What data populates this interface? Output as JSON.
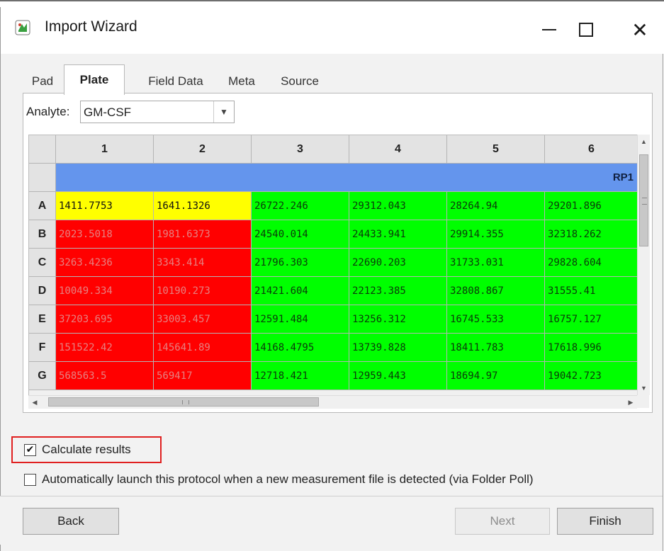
{
  "window": {
    "title": "Import Wizard",
    "icon": "app-icon"
  },
  "tabs": [
    {
      "label": "Pad",
      "active": false
    },
    {
      "label": "Plate",
      "active": true
    },
    {
      "label": "Field Data",
      "active": false
    },
    {
      "label": "Meta",
      "active": false
    },
    {
      "label": "Source",
      "active": false
    }
  ],
  "analyte": {
    "label": "Analyte:",
    "value": "GM-CSF"
  },
  "grid": {
    "columns": [
      "1",
      "2",
      "3",
      "4",
      "5",
      "6"
    ],
    "band_label": "RP1",
    "rows": [
      {
        "label": "A",
        "cells": [
          "1411.7753",
          "1641.1326",
          "26722.246",
          "29312.043",
          "28264.94",
          "29201.896"
        ],
        "colors": [
          "yellow",
          "yellow",
          "green",
          "green",
          "green",
          "green"
        ]
      },
      {
        "label": "B",
        "cells": [
          "2023.5018",
          "1981.6373",
          "24540.014",
          "24433.941",
          "29914.355",
          "32318.262"
        ],
        "colors": [
          "red",
          "red",
          "green",
          "green",
          "green",
          "green"
        ]
      },
      {
        "label": "C",
        "cells": [
          "3263.4236",
          "3343.414",
          "21796.303",
          "22690.203",
          "31733.031",
          "29828.604"
        ],
        "colors": [
          "red",
          "red",
          "green",
          "green",
          "green",
          "green"
        ]
      },
      {
        "label": "D",
        "cells": [
          "10049.334",
          "10190.273",
          "21421.604",
          "22123.385",
          "32808.867",
          "31555.41"
        ],
        "colors": [
          "red",
          "red",
          "green",
          "green",
          "green",
          "green"
        ]
      },
      {
        "label": "E",
        "cells": [
          "37203.695",
          "33003.457",
          "12591.484",
          "13256.312",
          "16745.533",
          "16757.127"
        ],
        "colors": [
          "red",
          "red",
          "green",
          "green",
          "green",
          "green"
        ]
      },
      {
        "label": "F",
        "cells": [
          "151522.42",
          "145641.89",
          "14168.4795",
          "13739.828",
          "18411.783",
          "17618.996"
        ],
        "colors": [
          "red",
          "red",
          "green",
          "green",
          "green",
          "green"
        ]
      },
      {
        "label": "G",
        "cells": [
          "568563.5",
          "569417",
          "12718.421",
          "12959.443",
          "18694.97",
          "19042.723"
        ],
        "colors": [
          "red",
          "red",
          "green",
          "green",
          "green",
          "green"
        ]
      }
    ],
    "cell_colors": {
      "yellow": "#ffff00",
      "red": "#ff0000",
      "green": "#00ff00",
      "band": "#6495ed"
    }
  },
  "options": {
    "calculate_results": {
      "label": "Calculate results",
      "checked": true
    },
    "auto_launch": {
      "label": "Automatically launch this protocol when a new measurement file is detected (via Folder Poll)",
      "checked": false
    }
  },
  "buttons": {
    "back": "Back",
    "next": "Next",
    "finish": "Finish"
  },
  "highlight_color": "#e02020"
}
